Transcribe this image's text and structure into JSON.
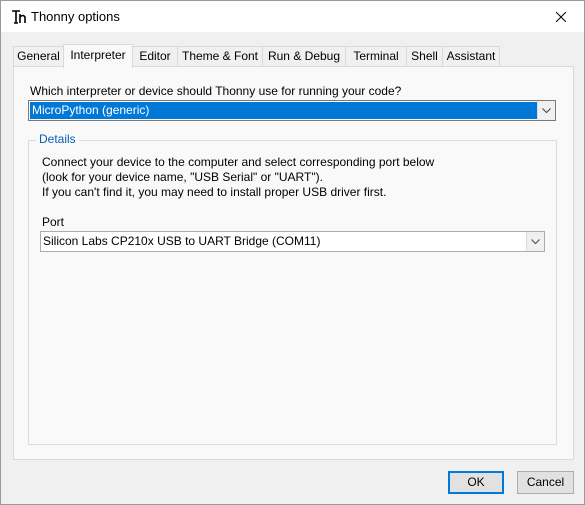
{
  "window": {
    "title": "Thonny options",
    "app_icon": "thonny-logo-icon",
    "close_icon": "close-icon"
  },
  "tabs": [
    {
      "label": "General",
      "active": false
    },
    {
      "label": "Interpreter",
      "active": true
    },
    {
      "label": "Editor",
      "active": false
    },
    {
      "label": "Theme & Font",
      "active": false
    },
    {
      "label": "Run & Debug",
      "active": false
    },
    {
      "label": "Terminal",
      "active": false
    },
    {
      "label": "Shell",
      "active": false
    },
    {
      "label": "Assistant",
      "active": false
    }
  ],
  "interpreter": {
    "question": "Which interpreter or device should Thonny use for running your code?",
    "selected": "MicroPython (generic)",
    "selection_color": "#0078d7"
  },
  "details": {
    "legend": "Details",
    "info_lines": [
      "Connect your device to the computer and select corresponding port below",
      "(look for your device name, \"USB Serial\" or \"UART\").",
      "If you can't find it, you may need to install proper USB driver first."
    ],
    "port_label": "Port",
    "port_selected": "Silicon Labs CP210x USB to UART Bridge (COM11)"
  },
  "buttons": {
    "ok": "OK",
    "cancel": "Cancel",
    "ok_border_color": "#0078d7"
  }
}
